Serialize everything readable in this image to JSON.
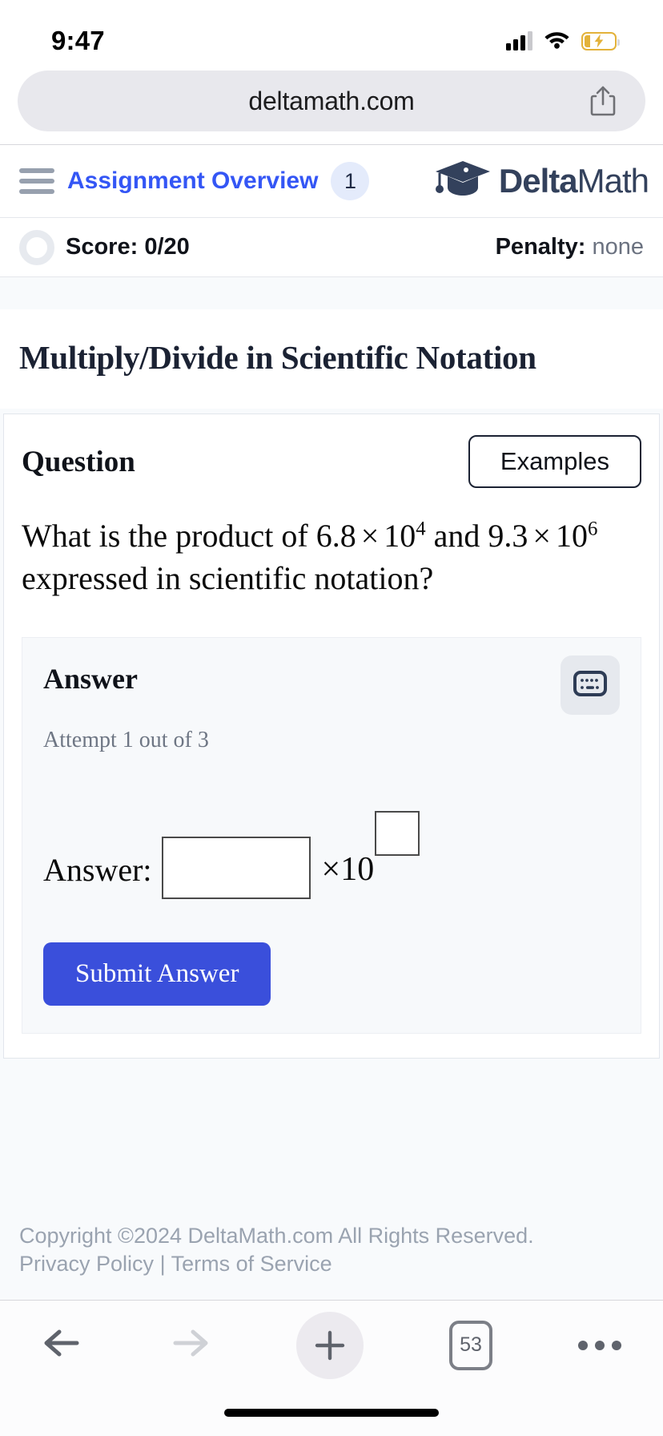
{
  "status_bar": {
    "time": "9:47",
    "signal_icon": "cellular-bars-icon",
    "wifi_icon": "wifi-icon",
    "battery_icon": "battery-charging-icon"
  },
  "browser": {
    "url": "deltamath.com",
    "share_icon": "share-icon",
    "toolbar": {
      "back_icon": "back-arrow-icon",
      "forward_icon": "forward-arrow-icon",
      "new_tab_icon": "plus-icon",
      "tab_count": "53",
      "more_icon": "more-dots-icon"
    }
  },
  "site_header": {
    "menu_icon": "hamburger-menu-icon",
    "nav_link": "Assignment Overview",
    "badge_count": "1",
    "brand_bold": "Delta",
    "brand_light": "Math",
    "brand_icon": "graduation-cap-icon"
  },
  "score_bar": {
    "progress_icon": "progress-ring-icon",
    "score_label": "Score: 0/20",
    "penalty_label": "Penalty:",
    "penalty_value": "none"
  },
  "assignment": {
    "title": "Multiply/Divide in Scientific Notation"
  },
  "question_card": {
    "heading": "Question",
    "examples_button": "Examples",
    "text_part_1": "What is the product of",
    "factor_1": {
      "mantissa": "6.8",
      "times": "×",
      "base": "10",
      "exponent": "4"
    },
    "text_part_2": "and",
    "factor_2": {
      "mantissa": "9.3",
      "times": "×",
      "base": "10",
      "exponent": "6"
    },
    "text_part_3": "expressed in scientific notation?"
  },
  "answer_panel": {
    "heading": "Answer",
    "keyboard_icon": "keyboard-icon",
    "attempt_text": "Attempt 1 out of 3",
    "answer_label": "Answer:",
    "mantissa_value": "",
    "mantissa_placeholder": "",
    "times_base": "×10",
    "exponent_value": "",
    "exponent_placeholder": "",
    "submit_button": "Submit Answer"
  },
  "footer": {
    "copyright": "Copyright ©2024 DeltaMath.com All Rights Reserved.",
    "privacy_link": "Privacy Policy",
    "separator": "|",
    "terms_link": "Terms of Service"
  },
  "colors": {
    "accent_blue": "#3a4fdb",
    "link_blue": "#3456f5",
    "brand_navy": "#33415c",
    "panel_bg": "#f7f9fb",
    "battery_yellow": "#e3b23a"
  }
}
